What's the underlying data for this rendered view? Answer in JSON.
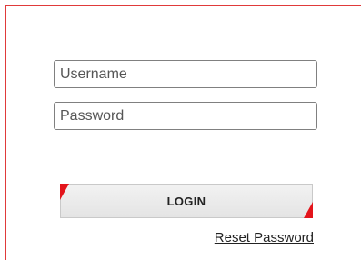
{
  "form": {
    "username": {
      "value": "",
      "placeholder": "Username"
    },
    "password": {
      "value": "",
      "placeholder": "Password"
    },
    "login_label": "LOGIN",
    "reset_label": "Reset Password"
  },
  "colors": {
    "accent": "#e3141b",
    "panel_border": "#e03a3a",
    "button_bg": "#ececec"
  }
}
